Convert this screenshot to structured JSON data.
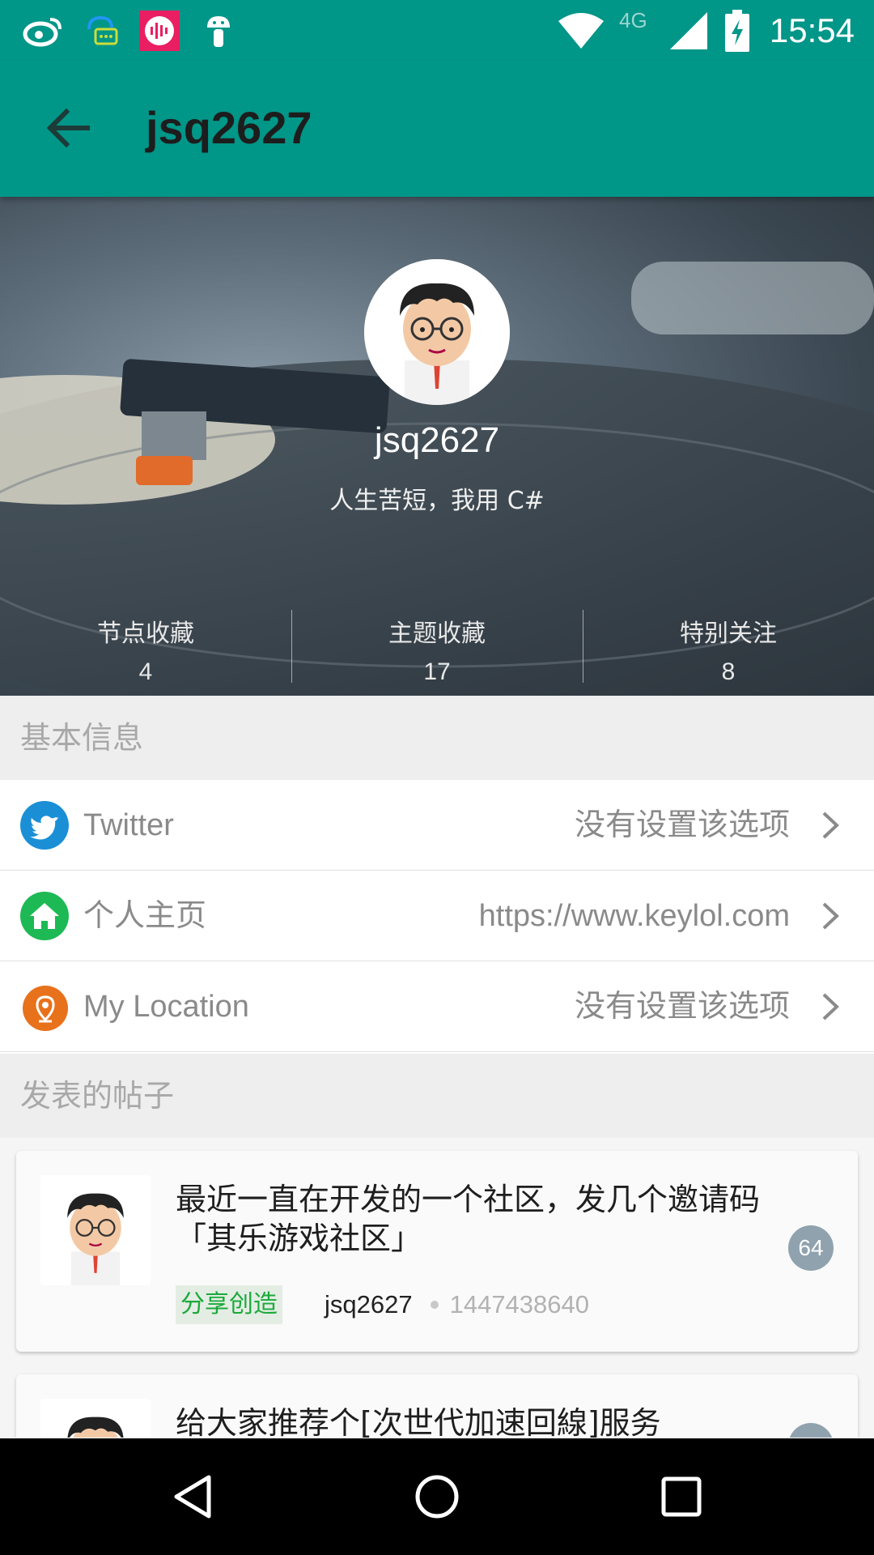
{
  "status_bar": {
    "time": "15:54",
    "network": "4G",
    "notification_icons": [
      "weibo-icon",
      "chat-bubble-icon",
      "voice-app-icon",
      "android-icon"
    ],
    "system_icons": [
      "wifi-icon",
      "cell-signal-icon",
      "battery-charging-icon"
    ]
  },
  "toolbar": {
    "title": "jsq2627",
    "back_icon": "arrow-back-icon",
    "color": "#009688"
  },
  "profile": {
    "username": "jsq2627",
    "motto": "人生苦短，我用 C#",
    "stats": [
      {
        "label": "节点收藏",
        "value": "4"
      },
      {
        "label": "主题收藏",
        "value": "17"
      },
      {
        "label": "特别关注",
        "value": "8"
      }
    ]
  },
  "basic_info": {
    "heading": "基本信息",
    "rows": [
      {
        "label": "Twitter",
        "value": "没有设置该选项",
        "icon": "twitter-icon",
        "icon_color": "#1a8fd6"
      },
      {
        "label": "个人主页",
        "value": "https://www.keylol.com",
        "icon": "home-icon",
        "icon_color": "#1db954"
      },
      {
        "label": "My Location",
        "value": "没有设置该选项",
        "icon": "location-pin-icon",
        "icon_color": "#e8711c"
      }
    ]
  },
  "posts": {
    "heading": "发表的帖子",
    "items": [
      {
        "title": "最近一直在开发的一个社区，发几个邀请码「其乐游戏社区」",
        "tag": "分享创造",
        "author": "jsq2627",
        "timestamp": "1447438640",
        "reply_count": "64"
      },
      {
        "title": "给大家推荐个[次世代加速回線]服务",
        "tag": "",
        "author": "",
        "timestamp": "",
        "reply_count": ""
      }
    ]
  },
  "nav_bar": {
    "buttons": [
      "back-triangle-icon",
      "home-circle-icon",
      "recents-square-icon"
    ]
  }
}
